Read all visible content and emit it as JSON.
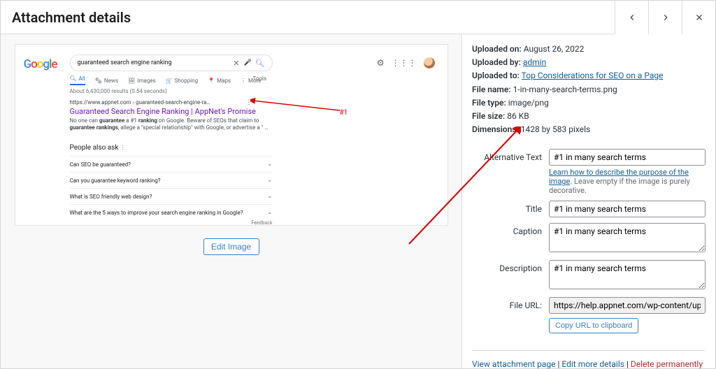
{
  "header": {
    "title": "Attachment details"
  },
  "preview": {
    "edit_image_label": "Edit Image",
    "annotation_marker": "#1",
    "screenshot": {
      "logo_letters": [
        "G",
        "o",
        "o",
        "g",
        "l",
        "e"
      ],
      "query": "guaranteed search engine ranking",
      "tabs": {
        "all": "All",
        "news": "News",
        "images": "Images",
        "shopping": "Shopping",
        "maps": "Maps",
        "more": "More"
      },
      "tools_label": "Tools",
      "stats": "About 6,430,000 results (0.54 seconds)",
      "result": {
        "url_display": "https://www.appnet.com › guaranteed-search-engine-ra…",
        "title": "Guaranteed Search Engine Ranking | AppNet's Promise",
        "desc_before": "No one can ",
        "desc_b1": "guarantee",
        "desc_mid1": " a #1 ",
        "desc_b2": "ranking",
        "desc_mid2": " on Google. Beware of SEOs that claim to ",
        "desc_b3": "guarantee rankings",
        "desc_after": ", allege a \"special relationship\" with Google, or advertise a \" …"
      },
      "paa_heading": "People also ask",
      "paa": [
        "Can SEO be guaranteed?",
        "Can you guarantee keyword ranking?",
        "What is SEO friendly web design?",
        "What are the 5 ways to improve your search engine ranking in Google?"
      ],
      "feedback": "Feedback"
    }
  },
  "meta": {
    "uploaded_on_label": "Uploaded on:",
    "uploaded_on": "August 26, 2022",
    "uploaded_by_label": "Uploaded by:",
    "uploaded_by": "admin",
    "uploaded_to_label": "Uploaded to:",
    "uploaded_to": "Top Considerations for SEO on a Page",
    "file_name_label": "File name:",
    "file_name": "1-in-many-search-terms.png",
    "file_type_label": "File type:",
    "file_type": "image/png",
    "file_size_label": "File size:",
    "file_size": "86 KB",
    "dimensions_label": "Dimensions:",
    "dimensions": "1428 by 583 pixels"
  },
  "fields": {
    "alt_label": "Alternative Text",
    "alt_value": "#1 in many search terms",
    "alt_help_link": "Learn how to describe the purpose of the image",
    "alt_help_tail": ". Leave empty if the image is purely decorative.",
    "title_label": "Title",
    "title_value": "#1 in many search terms",
    "caption_label": "Caption",
    "caption_value": "#1 in many search terms",
    "description_label": "Description",
    "description_value": "#1 in many search terms",
    "fileurl_label": "File URL:",
    "fileurl_value": "https://help.appnet.com/wp-content/upload",
    "copy_btn": "Copy URL to clipboard"
  },
  "actions": {
    "view": "View attachment page",
    "edit": "Edit more details",
    "delete": "Delete permanently",
    "sep": " | "
  }
}
